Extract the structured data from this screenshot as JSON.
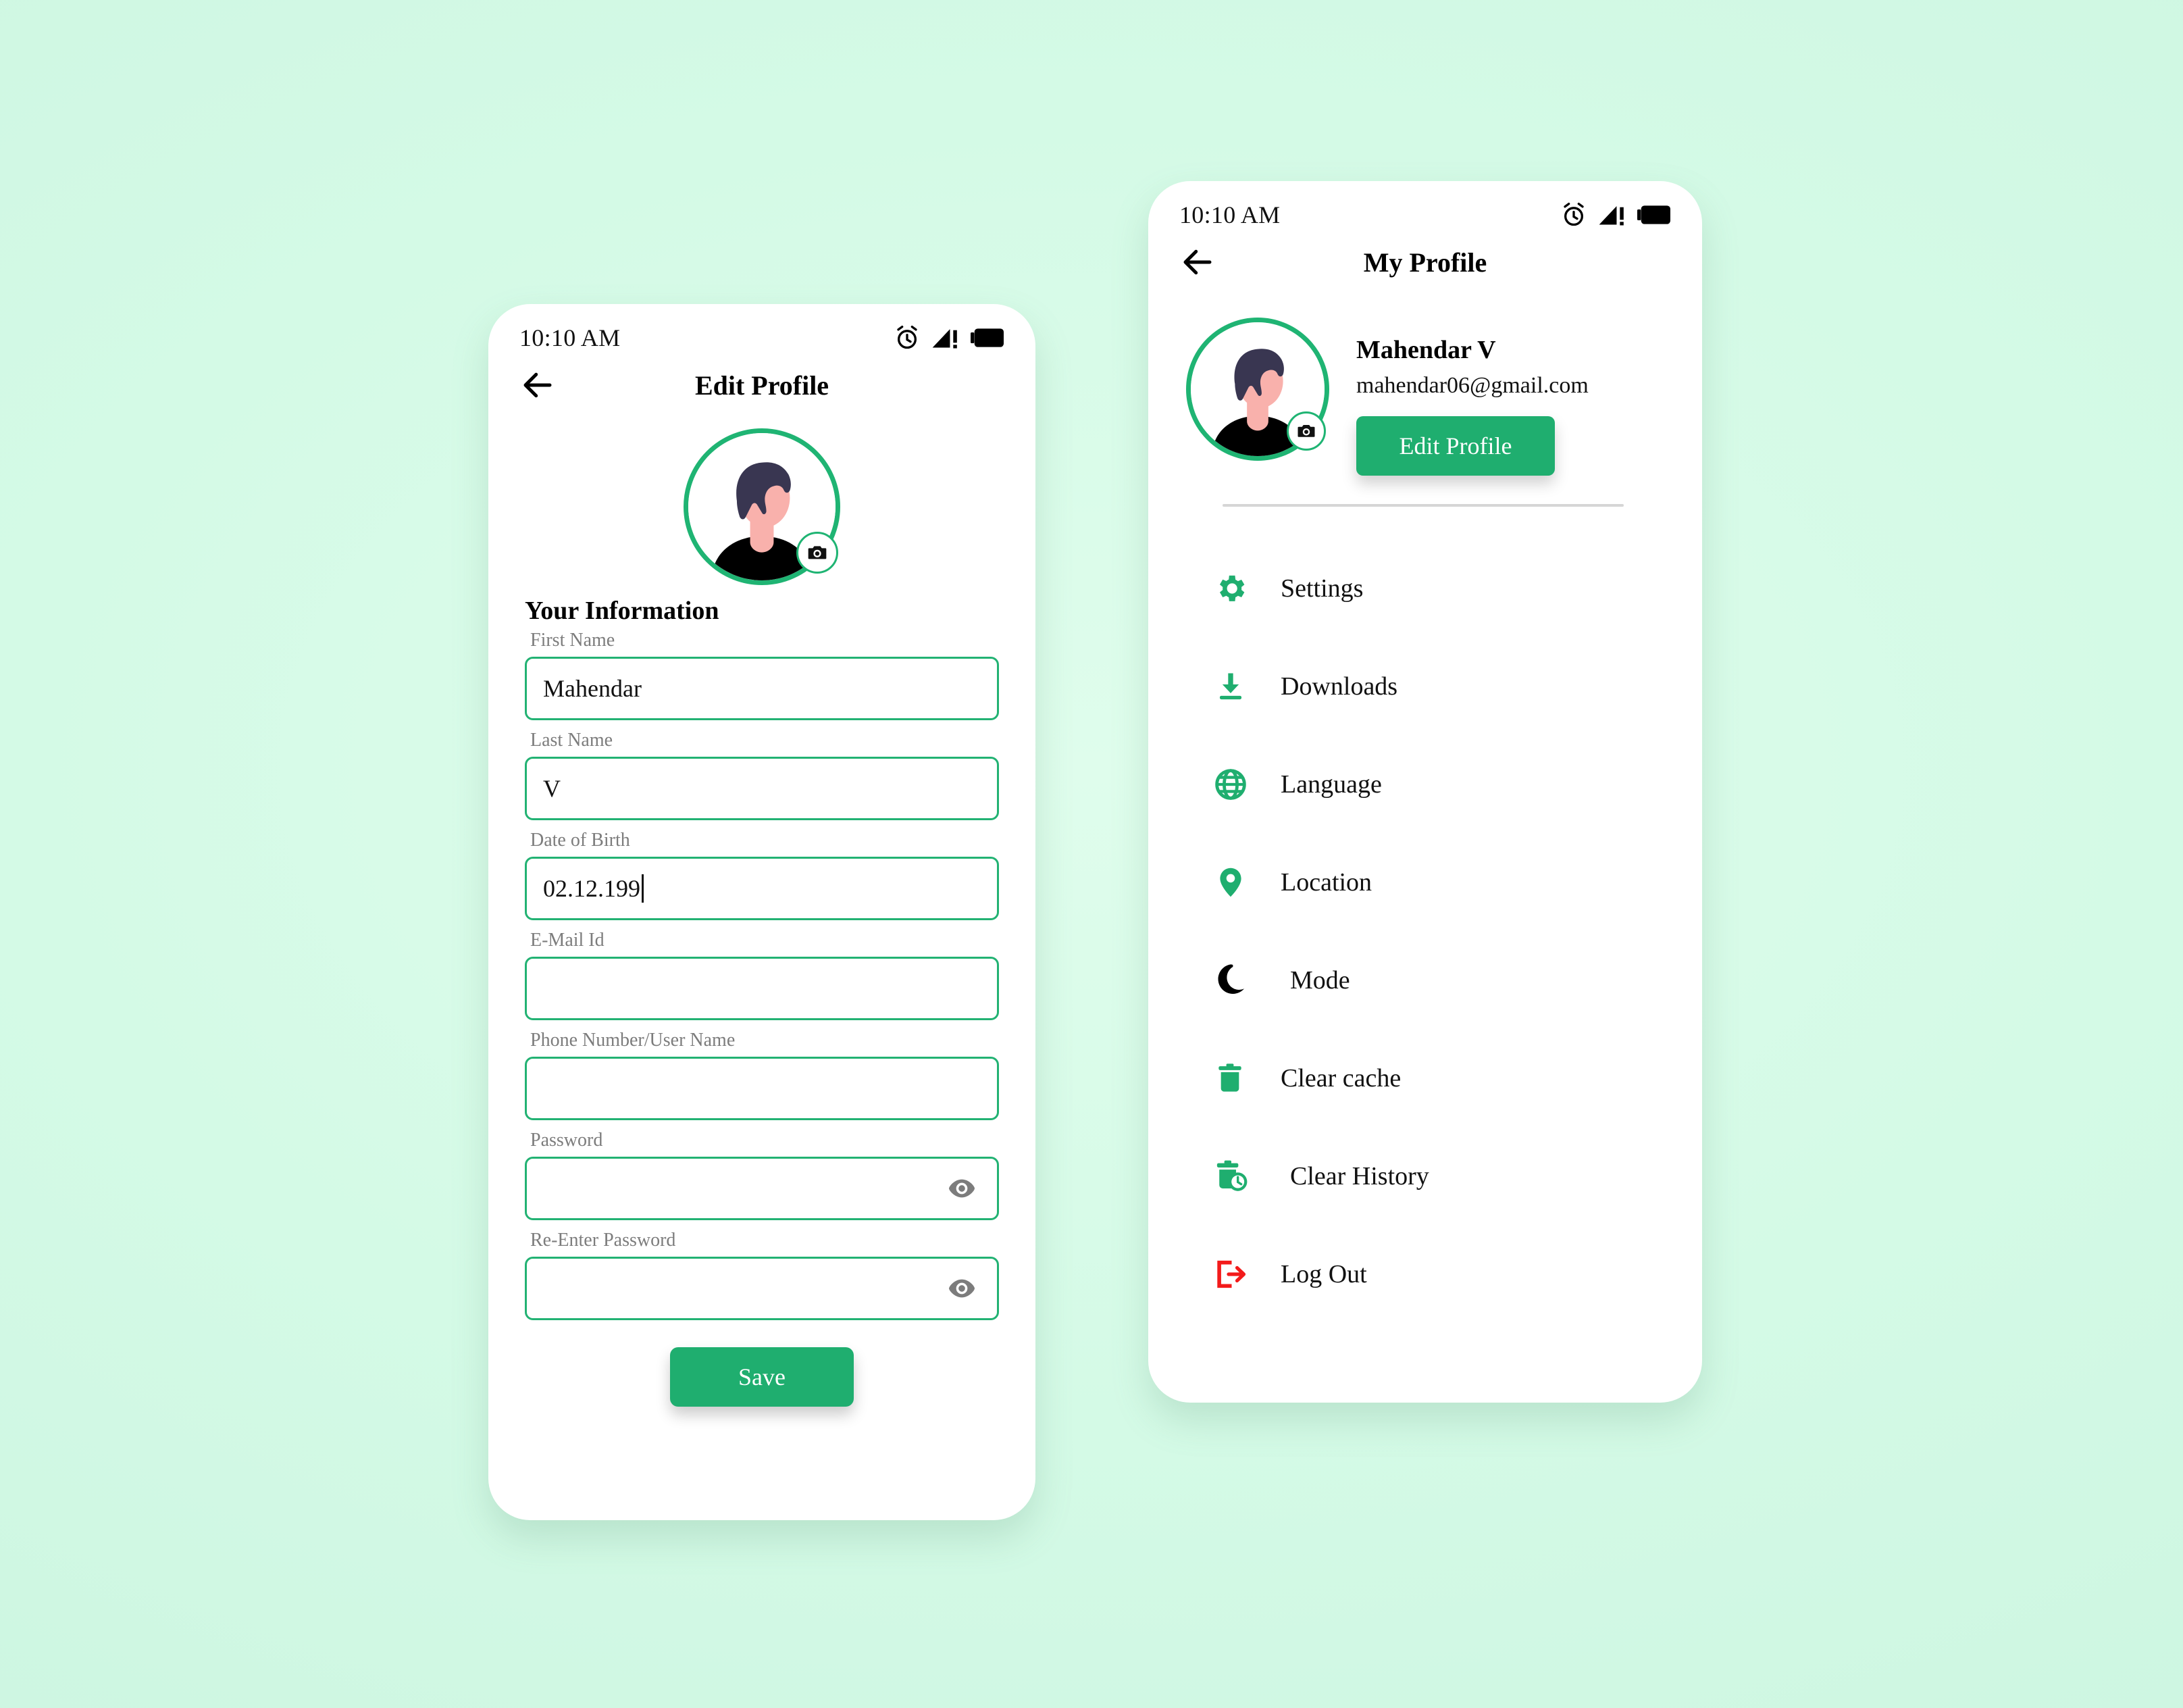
{
  "theme": {
    "background": "#d7fce8",
    "accent_green": "#1fae6f",
    "border_green": "#22b273",
    "logout_red": "#f31b1b",
    "label_gray": "#7c7c7c",
    "divider_gray": "#d6d6d6"
  },
  "edit_profile_screen": {
    "status_bar": {
      "time": "10:10 AM",
      "icons": [
        "alarm-icon",
        "signal-warning-icon",
        "battery-icon"
      ]
    },
    "app_bar": {
      "back_icon": "arrow-left-icon",
      "title": "Edit Profile"
    },
    "avatar": {
      "icon": "avatar-illustration",
      "camera_badge_icon": "camera-icon"
    },
    "section_title": "Your Information",
    "fields": [
      {
        "label": "First  Name",
        "value": "Mahendar",
        "placeholder": "",
        "caret": false,
        "has_eye": false
      },
      {
        "label": "Last  Name",
        "value": "V",
        "placeholder": "",
        "caret": false,
        "has_eye": false
      },
      {
        "label": "Date of Birth",
        "value": "02.12.199",
        "placeholder": "",
        "caret": true,
        "has_eye": false
      },
      {
        "label": "E-Mail Id",
        "value": "",
        "placeholder": "",
        "caret": false,
        "has_eye": false
      },
      {
        "label": "Phone Number/User Name",
        "value": "",
        "placeholder": "",
        "caret": false,
        "has_eye": false
      },
      {
        "label": "Password",
        "value": "",
        "placeholder": "",
        "caret": false,
        "has_eye": true
      },
      {
        "label": "Re-Enter Password",
        "value": "",
        "placeholder": "",
        "caret": false,
        "has_eye": true
      }
    ],
    "save_label": "Save"
  },
  "my_profile_screen": {
    "status_bar": {
      "time": "10:10 AM",
      "icons": [
        "alarm-icon",
        "signal-warning-icon",
        "battery-icon"
      ]
    },
    "app_bar": {
      "back_icon": "arrow-left-icon",
      "title": "My Profile"
    },
    "avatar": {
      "icon": "avatar-illustration",
      "camera_badge_icon": "camera-icon"
    },
    "user": {
      "name": "Mahendar V",
      "email": "mahendar06@gmail.com"
    },
    "edit_profile_label": "Edit Profile",
    "menu": [
      {
        "label": "Settings",
        "icon": "gear-icon",
        "color": "#1fae6f"
      },
      {
        "label": "Downloads",
        "icon": "download-icon",
        "color": "#1fae6f"
      },
      {
        "label": "Language",
        "icon": "globe-icon",
        "color": "#1fae6f"
      },
      {
        "label": "Location",
        "icon": "map-pin-icon",
        "color": "#1fae6f"
      },
      {
        "label": "Mode",
        "icon": "moon-icon",
        "color": "#000000"
      },
      {
        "label": "Clear cache",
        "icon": "trash-icon",
        "color": "#1fae6f"
      },
      {
        "label": "Clear History",
        "icon": "trash-clock-icon",
        "color": "#1fae6f"
      },
      {
        "label": "Log Out",
        "icon": "logout-icon",
        "color": "#f31b1b"
      }
    ]
  }
}
